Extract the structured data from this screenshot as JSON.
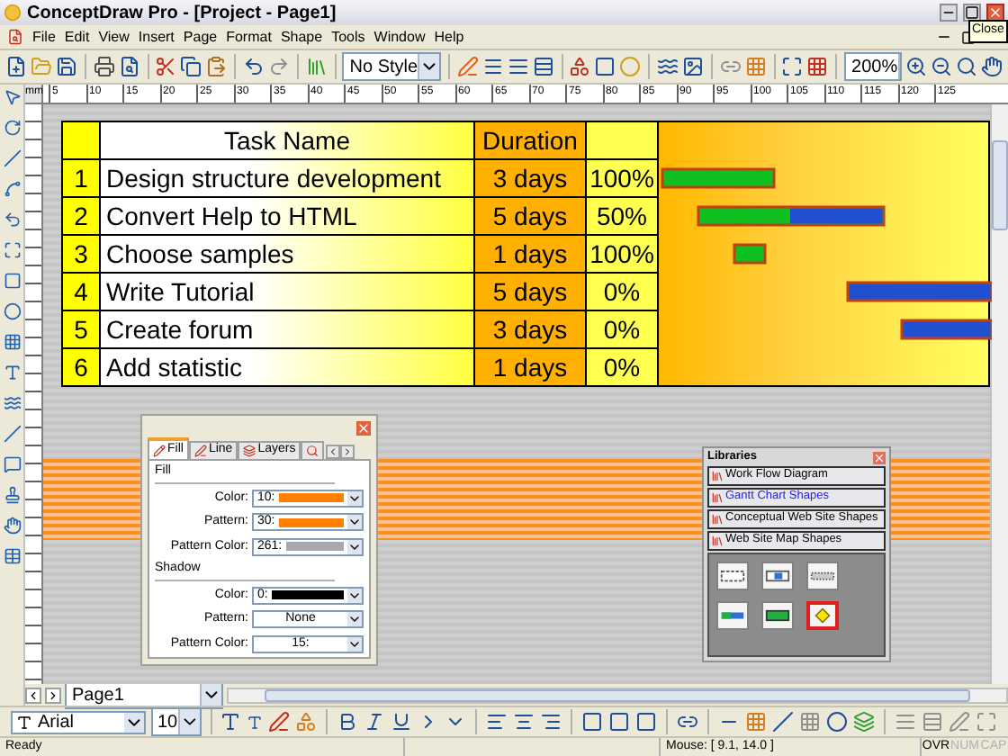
{
  "window": {
    "title": "ConceptDraw Pro - [Project - Page1]",
    "tooltip": "Close"
  },
  "menu": [
    "File",
    "Edit",
    "View",
    "Insert",
    "Page",
    "Format",
    "Shape",
    "Tools",
    "Window",
    "Help"
  ],
  "toolbar": {
    "style": "No Style",
    "zoom": "200%"
  },
  "ruler": {
    "unit": "mm",
    "ticks": [
      "5",
      "10",
      "15",
      "20",
      "25",
      "30",
      "35",
      "40",
      "45",
      "50",
      "55",
      "60",
      "65",
      "70",
      "75",
      "80",
      "85",
      "90",
      "95",
      "100",
      "105",
      "110",
      "115",
      "120",
      "125"
    ]
  },
  "gantt": {
    "columns": [
      "Task Name",
      "Duration"
    ],
    "rows": [
      {
        "number": "1",
        "task": "Design structure development",
        "duration": "3 days",
        "complete": "100%"
      },
      {
        "number": "2",
        "task": "Convert Help to HTML",
        "duration": "5 days",
        "complete": "50%"
      },
      {
        "number": "3",
        "task": "Choose samples",
        "duration": "1 days",
        "complete": "100%"
      },
      {
        "number": "4",
        "task": "Write Tutorial",
        "duration": "5 days",
        "complete": "0%"
      },
      {
        "number": "5",
        "task": "Create forum",
        "duration": "3 days",
        "complete": "0%"
      },
      {
        "number": "6",
        "task": "Add statistic",
        "duration": "1 days",
        "complete": "0%"
      }
    ]
  },
  "fill_panel": {
    "tabs": [
      {
        "kind": "fill",
        "label": "Fill",
        "selected": true
      },
      {
        "kind": "line",
        "label": "Line",
        "selected": false
      },
      {
        "kind": "layers",
        "label": "Layers",
        "selected": false
      },
      {
        "kind": "icon",
        "selected": false
      }
    ],
    "sections": [
      {
        "title": "Fill",
        "fields": [
          {
            "label": "Color:",
            "value": "10:",
            "color": "#ff8000"
          },
          {
            "label": "Pattern:",
            "value": "30:",
            "color": "#ff8000"
          },
          {
            "label": "Pattern Color:",
            "value": "261:",
            "color": "#a8a8b0"
          }
        ]
      },
      {
        "title": "Shadow",
        "fields": [
          {
            "label": "Color:",
            "value": "0:",
            "color": "#000000"
          },
          {
            "label": "Pattern:",
            "value": "None"
          },
          {
            "label": "Pattern Color:",
            "value": "15:"
          }
        ]
      }
    ]
  },
  "libraries": {
    "title": "Libraries",
    "items": [
      {
        "label": "Work Flow Diagram",
        "selected": false
      },
      {
        "label": "Gantt Chart Shapes",
        "selected": true
      },
      {
        "label": "Conceptual Web Site Shapes",
        "selected": false
      },
      {
        "label": "Web Site Map Shapes",
        "selected": false
      }
    ],
    "shapes": [
      {
        "kind": "grid",
        "selected": false
      },
      {
        "kind": "boxes",
        "selected": false
      },
      {
        "kind": "dotted",
        "selected": false
      },
      {
        "kind": "progress",
        "selected": false
      },
      {
        "kind": "green",
        "selected": false
      },
      {
        "kind": "milestone",
        "selected": true
      }
    ]
  },
  "page_bar": {
    "page": "Page1"
  },
  "format_toolbar": {
    "font": "Arial",
    "size": "10"
  },
  "status_bar": {
    "message": "Ready",
    "mouse": "Mouse: [ 9.1, 14.0 ]",
    "indicators": [
      {
        "label": "OVR",
        "disabled": false
      },
      {
        "label": "NUM",
        "disabled": true
      },
      {
        "label": "CAP",
        "disabled": true
      }
    ]
  }
}
